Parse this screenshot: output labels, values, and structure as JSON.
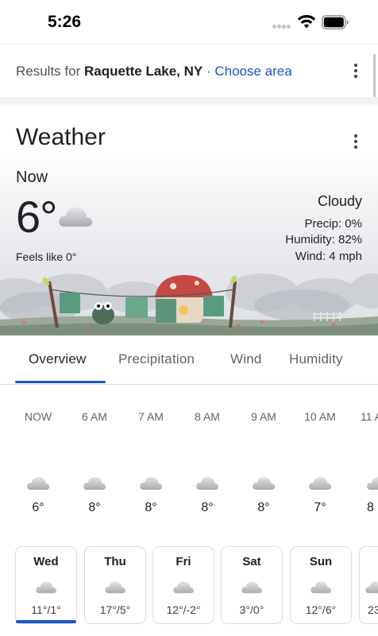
{
  "status_bar": {
    "time": "5:26",
    "icons": [
      "signal-dots-icon",
      "wifi-icon",
      "battery-icon"
    ]
  },
  "results": {
    "prefix": "Results for ",
    "location": "Raquette Lake, NY",
    "separator": " · ",
    "choose_area": "Choose area"
  },
  "weather": {
    "title": "Weather",
    "now_label": "Now",
    "temperature": "6°",
    "feels_like": "Feels like 0°",
    "condition": "Cloudy",
    "precip": "Precip: 0%",
    "humidity": "Humidity: 82%",
    "wind": "Wind: 4 mph",
    "condition_icon": "cloud-icon"
  },
  "tabs": [
    {
      "label": "Overview",
      "active": true
    },
    {
      "label": "Precipitation",
      "active": false
    },
    {
      "label": "Wind",
      "active": false
    },
    {
      "label": "Humidity",
      "active": false
    }
  ],
  "hourly": [
    {
      "time": "NOW",
      "temp": "6°",
      "icon": "cloud-icon"
    },
    {
      "time": "6 AM",
      "temp": "8°",
      "icon": "cloud-icon"
    },
    {
      "time": "7 AM",
      "temp": "8°",
      "icon": "cloud-icon"
    },
    {
      "time": "8 AM",
      "temp": "8°",
      "icon": "cloud-icon"
    },
    {
      "time": "9 AM",
      "temp": "8°",
      "icon": "cloud-icon"
    },
    {
      "time": "10 AM",
      "temp": "7°",
      "icon": "cloud-icon"
    },
    {
      "time": "11 A",
      "temp": "8",
      "icon": "cloud-icon"
    }
  ],
  "daily": [
    {
      "day": "Wed",
      "temps": "11°/1°",
      "selected": true,
      "icon": "cloud-icon"
    },
    {
      "day": "Thu",
      "temps": "17°/5°",
      "selected": false,
      "icon": "cloud-icon"
    },
    {
      "day": "Fri",
      "temps": "12°/-2°",
      "selected": false,
      "icon": "cloud-icon"
    },
    {
      "day": "Sat",
      "temps": "3°/0°",
      "selected": false,
      "icon": "cloud-icon"
    },
    {
      "day": "Sun",
      "temps": "12°/6°",
      "selected": false,
      "icon": "cloud-icon"
    },
    {
      "day": "",
      "temps": "23",
      "selected": false,
      "icon": "cloud-icon"
    }
  ],
  "colors": {
    "accent": "#1a57c6",
    "text": "#202124",
    "muted": "#5f6368",
    "border": "#dadce0"
  }
}
